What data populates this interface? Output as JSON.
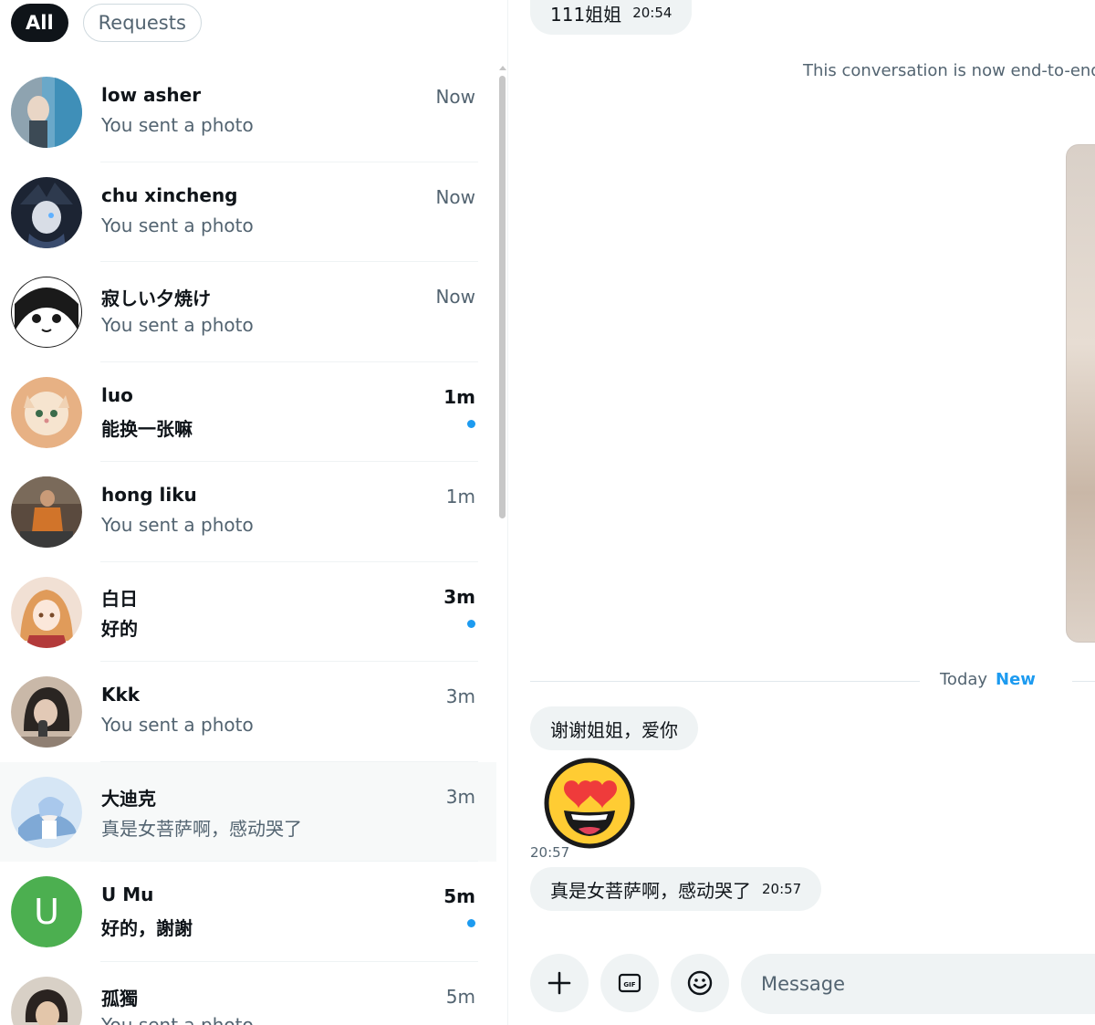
{
  "filters": {
    "all_label": "All",
    "requests_label": "Requests"
  },
  "conversations": [
    {
      "name": "low asher",
      "preview": "You sent a photo",
      "time": "Now",
      "unread": false,
      "avatar": "photo-avatar"
    },
    {
      "name": "chu xincheng",
      "preview": "You sent a photo",
      "time": "Now",
      "unread": false,
      "avatar": "anime-avatar"
    },
    {
      "name": "寂しい夕焼け",
      "preview": "You sent a photo",
      "time": "Now",
      "unread": false,
      "avatar": "anime-avatar"
    },
    {
      "name": "luo",
      "preview": "能换一张嘛",
      "time": "1m",
      "unread": true,
      "avatar": "cat-avatar"
    },
    {
      "name": "hong liku",
      "preview": "You sent a photo",
      "time": "1m",
      "unread": false,
      "avatar": "photo-avatar"
    },
    {
      "name": "白日",
      "preview": "好的",
      "time": "3m",
      "unread": true,
      "avatar": "anime-avatar"
    },
    {
      "name": "Kkk",
      "preview": "You sent a photo",
      "time": "3m",
      "unread": false,
      "avatar": "photo-avatar"
    },
    {
      "name": "大迪克",
      "preview": "真是女菩萨啊，感动哭了",
      "time": "3m",
      "unread": false,
      "avatar": "anime-avatar",
      "selected": true
    },
    {
      "name": "U Mu",
      "preview": "好的，謝謝",
      "time": "5m",
      "unread": true,
      "avatar": "letter-avatar",
      "letter": "U"
    },
    {
      "name": "孤獨",
      "preview": "You sent a photo",
      "time": "5m",
      "unread": false,
      "avatar": "photo-avatar"
    }
  ],
  "chat": {
    "msg1_text": "111姐姐",
    "msg1_time": "20:54",
    "encryption_note": "This conversation is now end-to-end e",
    "divider_today": "Today",
    "divider_new": "New",
    "msg2_text": "谢谢姐姐，爱你",
    "emoji_time": "20:57",
    "msg3_text": "真是女菩萨啊，感动哭了",
    "msg3_time": "20:57"
  },
  "composer": {
    "placeholder": "Message",
    "gif_label": "GIF"
  },
  "colors": {
    "accent": "#1d9bf0",
    "text": "#0f1419",
    "muted": "#536471",
    "bubble": "#eff3f4",
    "letter_avatar": "#4caf50"
  }
}
